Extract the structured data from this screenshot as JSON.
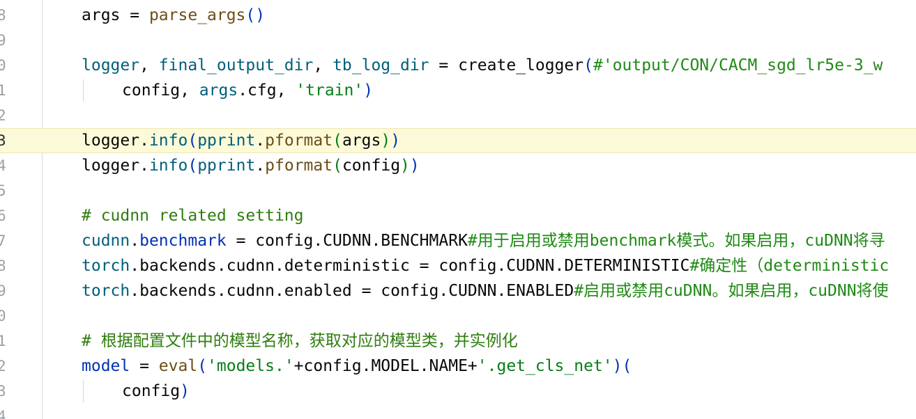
{
  "editor": {
    "lines": [
      {
        "num": "8",
        "segs": [
          {
            "t": "args",
            "c": "n"
          },
          {
            "t": " = ",
            "c": "p"
          },
          {
            "t": "parse_args",
            "c": "fn"
          },
          {
            "t": "()",
            "c": "blue"
          }
        ]
      },
      {
        "num": "9",
        "segs": []
      },
      {
        "num": "0",
        "segs": [
          {
            "t": "logger",
            "c": "teal"
          },
          {
            "t": ", ",
            "c": "p"
          },
          {
            "t": "final_output_dir",
            "c": "teal"
          },
          {
            "t": ", ",
            "c": "p"
          },
          {
            "t": "tb_log_dir",
            "c": "teal"
          },
          {
            "t": " = ",
            "c": "p"
          },
          {
            "t": "create_logger",
            "c": "n"
          },
          {
            "t": "(",
            "c": "blue"
          },
          {
            "t": "#'output/CON/CACM_sgd_lr5e-3_w",
            "c": "cmt-inline"
          }
        ]
      },
      {
        "num": "1",
        "segs": [
          {
            "t": "config",
            "c": "n"
          },
          {
            "t": ", ",
            "c": "p"
          },
          {
            "t": "args",
            "c": "teal"
          },
          {
            "t": ".cfg, ",
            "c": "p"
          },
          {
            "t": "'train'",
            "c": "str"
          },
          {
            "t": ")",
            "c": "blue"
          }
        ],
        "indent": true
      },
      {
        "num": "2",
        "segs": []
      },
      {
        "num": "3",
        "segs": [
          {
            "t": "logger",
            "c": "n"
          },
          {
            "t": ".",
            "c": "p"
          },
          {
            "t": "info",
            "c": "teal"
          },
          {
            "t": "(",
            "c": "blue"
          },
          {
            "t": "pprint",
            "c": "teal"
          },
          {
            "t": ".",
            "c": "p"
          },
          {
            "t": "pformat",
            "c": "fn"
          },
          {
            "t": "(",
            "c": "str"
          },
          {
            "t": "args",
            "c": "n"
          },
          {
            "t": ")",
            "c": "str"
          },
          {
            "t": ")",
            "c": "blue"
          }
        ],
        "current": true
      },
      {
        "num": "4",
        "segs": [
          {
            "t": "logger",
            "c": "n"
          },
          {
            "t": ".",
            "c": "p"
          },
          {
            "t": "info",
            "c": "teal"
          },
          {
            "t": "(",
            "c": "blue"
          },
          {
            "t": "pprint",
            "c": "teal"
          },
          {
            "t": ".",
            "c": "p"
          },
          {
            "t": "pformat",
            "c": "fn"
          },
          {
            "t": "(",
            "c": "str"
          },
          {
            "t": "config",
            "c": "n"
          },
          {
            "t": ")",
            "c": "str"
          },
          {
            "t": ")",
            "c": "blue"
          }
        ]
      },
      {
        "num": "5",
        "segs": []
      },
      {
        "num": "6",
        "segs": [
          {
            "t": "# cudnn related setting",
            "c": "comment"
          }
        ]
      },
      {
        "num": "7",
        "segs": [
          {
            "t": "cudnn",
            "c": "teal"
          },
          {
            "t": ".",
            "c": "p"
          },
          {
            "t": "benchmark",
            "c": "blue"
          },
          {
            "t": " = config.CUDNN.BENCHMARK",
            "c": "p"
          },
          {
            "t": "#用于启用或禁用benchmark模式。如果启用，cuDNN将寻",
            "c": "cmt-inline"
          }
        ]
      },
      {
        "num": "8",
        "segs": [
          {
            "t": "torch",
            "c": "teal"
          },
          {
            "t": ".backends.cudnn.deterministic = config.CUDNN.DETERMINISTIC",
            "c": "p"
          },
          {
            "t": "#确定性（deterministic",
            "c": "cmt-inline"
          }
        ]
      },
      {
        "num": "9",
        "segs": [
          {
            "t": "torch",
            "c": "teal"
          },
          {
            "t": ".backends.cudnn.enabled = config.CUDNN.ENABLED",
            "c": "p"
          },
          {
            "t": "#启用或禁用cuDNN。如果启用，cuDNN将使",
            "c": "cmt-inline"
          }
        ]
      },
      {
        "num": "0",
        "segs": []
      },
      {
        "num": "1",
        "segs": [
          {
            "t": "# 根据配置文件中的模型名称，获取对应的模型类，并实例化",
            "c": "comment"
          }
        ]
      },
      {
        "num": "2",
        "segs": [
          {
            "t": "model",
            "c": "blue"
          },
          {
            "t": " = ",
            "c": "p"
          },
          {
            "t": "eval",
            "c": "fn"
          },
          {
            "t": "(",
            "c": "blue"
          },
          {
            "t": "'models.'",
            "c": "str"
          },
          {
            "t": "+config.MODEL.NAME+",
            "c": "p"
          },
          {
            "t": "'.get_cls_net'",
            "c": "str"
          },
          {
            "t": ")(",
            "c": "blue"
          }
        ]
      },
      {
        "num": "3",
        "segs": [
          {
            "t": "config",
            "c": "n"
          },
          {
            "t": ")",
            "c": "blue"
          }
        ],
        "indent": true
      },
      {
        "num": "4",
        "segs": []
      }
    ]
  }
}
